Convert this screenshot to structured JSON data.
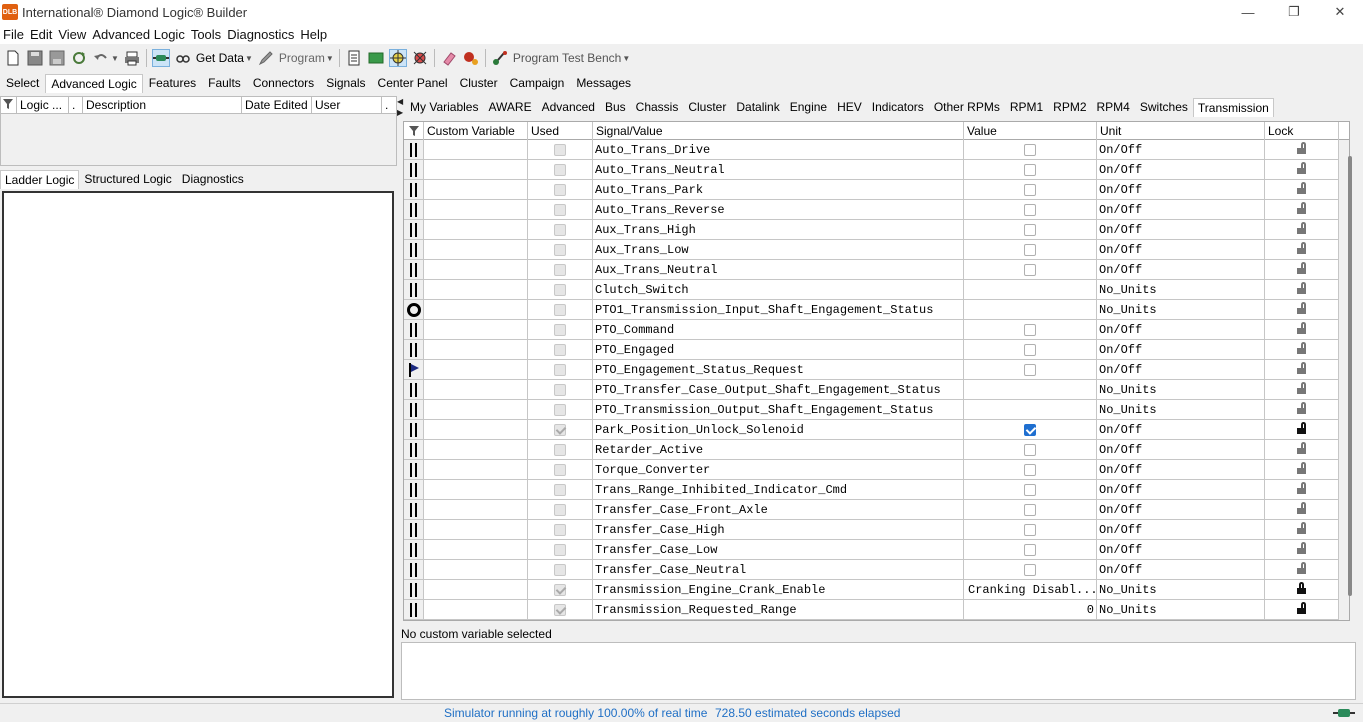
{
  "window": {
    "title": "International® Diamond Logic® Builder",
    "app_icon_text": "DLB",
    "minimize": "—",
    "maximize": "❐",
    "close": "✕"
  },
  "menu": [
    "File",
    "Edit",
    "View",
    "Advanced Logic",
    "Tools",
    "Diagnostics",
    "Help"
  ],
  "toolbar": {
    "get_data_label": "Get Data",
    "program_label": "Program",
    "program_test_bench_label": "Program Test Bench"
  },
  "main_tabs": [
    "Select",
    "Advanced Logic",
    "Features",
    "Faults",
    "Connectors",
    "Signals",
    "Center Panel",
    "Cluster",
    "Campaign",
    "Messages"
  ],
  "main_tab_active": 1,
  "left_header": {
    "logic": "Logic ...",
    "dot1": ".",
    "description": "Description",
    "date_edited": "Date Edited",
    "user": "User",
    "dot2": "."
  },
  "left_tabs": [
    "Ladder Logic",
    "Structured Logic",
    "Diagnostics"
  ],
  "left_tab_active": 0,
  "right_tabs": [
    "My Variables",
    "AWARE",
    "Advanced",
    "Bus",
    "Chassis",
    "Cluster",
    "Datalink",
    "Engine",
    "HEV",
    "Indicators",
    "Other RPMs",
    "RPM1",
    "RPM2",
    "RPM4",
    "Switches",
    "Transmission"
  ],
  "right_tab_active": 15,
  "grid": {
    "headers": {
      "custom_variable": "Custom Variable",
      "used": "Used",
      "signal_value": "Signal/Value",
      "value": "Value",
      "unit": "Unit",
      "lock": "Lock"
    },
    "rows": [
      {
        "icon": "bars",
        "signal": "Auto_Trans_Drive",
        "used": "dim",
        "value_type": "checkbox",
        "value": "unchecked",
        "value_text": "",
        "unit": "On/Off",
        "lock": "open"
      },
      {
        "icon": "bars",
        "signal": "Auto_Trans_Neutral",
        "used": "dim",
        "value_type": "checkbox",
        "value": "unchecked",
        "value_text": "",
        "unit": "On/Off",
        "lock": "open"
      },
      {
        "icon": "bars",
        "signal": "Auto_Trans_Park",
        "used": "dim",
        "value_type": "checkbox",
        "value": "unchecked",
        "value_text": "",
        "unit": "On/Off",
        "lock": "open"
      },
      {
        "icon": "bars",
        "signal": "Auto_Trans_Reverse",
        "used": "dim",
        "value_type": "checkbox",
        "value": "unchecked",
        "value_text": "",
        "unit": "On/Off",
        "lock": "open"
      },
      {
        "icon": "bars",
        "signal": "Aux_Trans_High",
        "used": "dim",
        "value_type": "checkbox",
        "value": "unchecked",
        "value_text": "",
        "unit": "On/Off",
        "lock": "open"
      },
      {
        "icon": "bars",
        "signal": "Aux_Trans_Low",
        "used": "dim",
        "value_type": "checkbox",
        "value": "unchecked",
        "value_text": "",
        "unit": "On/Off",
        "lock": "open"
      },
      {
        "icon": "bars",
        "signal": "Aux_Trans_Neutral",
        "used": "dim",
        "value_type": "checkbox",
        "value": "unchecked",
        "value_text": "",
        "unit": "On/Off",
        "lock": "open"
      },
      {
        "icon": "bars",
        "signal": "Clutch_Switch",
        "used": "dim",
        "value_type": "none",
        "value": "",
        "value_text": "",
        "unit": "No_Units",
        "lock": "open"
      },
      {
        "icon": "circle",
        "signal": "PTO1_Transmission_Input_Shaft_Engagement_Status",
        "used": "dim",
        "value_type": "none",
        "value": "",
        "value_text": "",
        "unit": "No_Units",
        "lock": "open"
      },
      {
        "icon": "bars",
        "signal": "PTO_Command",
        "used": "dim",
        "value_type": "checkbox",
        "value": "unchecked",
        "value_text": "",
        "unit": "On/Off",
        "lock": "open"
      },
      {
        "icon": "bars",
        "signal": "PTO_Engaged",
        "used": "dim",
        "value_type": "checkbox",
        "value": "unchecked",
        "value_text": "",
        "unit": "On/Off",
        "lock": "open"
      },
      {
        "icon": "flag",
        "signal": "PTO_Engagement_Status_Request",
        "used": "dim",
        "value_type": "checkbox",
        "value": "unchecked",
        "value_text": "",
        "unit": "On/Off",
        "lock": "open"
      },
      {
        "icon": "bars",
        "signal": "PTO_Transfer_Case_Output_Shaft_Engagement_Status",
        "used": "dim",
        "value_type": "none",
        "value": "",
        "value_text": "",
        "unit": "No_Units",
        "lock": "open"
      },
      {
        "icon": "bars",
        "signal": "PTO_Transmission_Output_Shaft_Engagement_Status",
        "used": "dim",
        "value_type": "none",
        "value": "",
        "value_text": "",
        "unit": "No_Units",
        "lock": "open"
      },
      {
        "icon": "bars",
        "signal": "Park_Position_Unlock_Solenoid",
        "used": "dim-checked",
        "value_type": "checkbox",
        "value": "checked",
        "value_text": "",
        "unit": "On/Off",
        "lock": "open-dark"
      },
      {
        "icon": "bars",
        "signal": "Retarder_Active",
        "used": "dim",
        "value_type": "checkbox",
        "value": "unchecked",
        "value_text": "",
        "unit": "On/Off",
        "lock": "open"
      },
      {
        "icon": "bars",
        "signal": "Torque_Converter",
        "used": "dim",
        "value_type": "checkbox",
        "value": "unchecked",
        "value_text": "",
        "unit": "On/Off",
        "lock": "open"
      },
      {
        "icon": "bars",
        "signal": "Trans_Range_Inhibited_Indicator_Cmd",
        "used": "dim",
        "value_type": "checkbox",
        "value": "unchecked",
        "value_text": "",
        "unit": "On/Off",
        "lock": "open"
      },
      {
        "icon": "bars",
        "signal": "Transfer_Case_Front_Axle",
        "used": "dim",
        "value_type": "checkbox",
        "value": "unchecked",
        "value_text": "",
        "unit": "On/Off",
        "lock": "open"
      },
      {
        "icon": "bars",
        "signal": "Transfer_Case_High",
        "used": "dim",
        "value_type": "checkbox",
        "value": "unchecked",
        "value_text": "",
        "unit": "On/Off",
        "lock": "open"
      },
      {
        "icon": "bars",
        "signal": "Transfer_Case_Low",
        "used": "dim",
        "value_type": "checkbox",
        "value": "unchecked",
        "value_text": "",
        "unit": "On/Off",
        "lock": "open"
      },
      {
        "icon": "bars",
        "signal": "Transfer_Case_Neutral",
        "used": "dim",
        "value_type": "checkbox",
        "value": "unchecked",
        "value_text": "",
        "unit": "On/Off",
        "lock": "open"
      },
      {
        "icon": "bars",
        "signal": "Transmission_Engine_Crank_Enable",
        "used": "dim-checked",
        "value_type": "text",
        "value": "",
        "value_text": "Cranking Disabl...",
        "unit": "No_Units",
        "lock": "closed-dark"
      },
      {
        "icon": "bars",
        "signal": "Transmission_Requested_Range",
        "used": "dim-checked",
        "value_type": "number",
        "value": "",
        "value_text": "0",
        "unit": "No_Units",
        "lock": "open-dark"
      }
    ]
  },
  "selection_status": "No custom variable selected",
  "status_bar": {
    "simulator": "Simulator running at roughly 100.00% of real time",
    "elapsed": "728.50 estimated seconds elapsed"
  }
}
